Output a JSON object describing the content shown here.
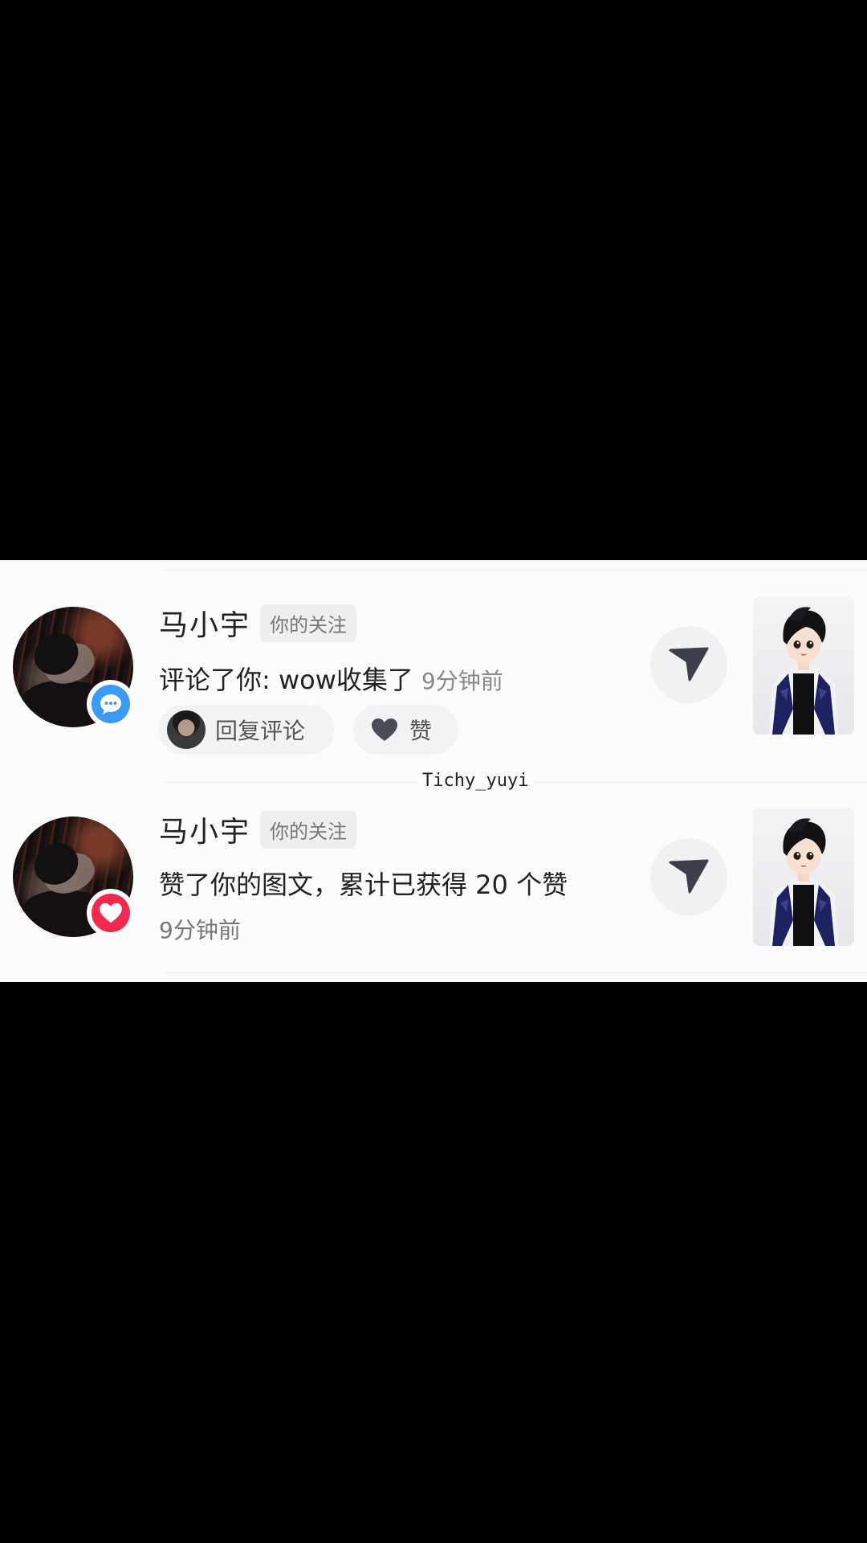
{
  "notifications": [
    {
      "user_name": "马小宇",
      "follow_tag": "你的关注",
      "badge_icon": "comment-bubble-icon",
      "badge_color": "#3b9af4",
      "message": "评论了你: wow收集了",
      "time": "9分钟前",
      "actions": {
        "reply_label": "回复评论",
        "like_label": "赞"
      }
    },
    {
      "user_name": "马小宇",
      "follow_tag": "你的关注",
      "badge_icon": "heart-icon",
      "badge_color": "#f0294f",
      "message": "赞了你的图文，累计已获得 20 个赞",
      "time": "9分钟前"
    }
  ],
  "watermark": "Tichy_yuyi",
  "colors": {
    "background": "#000000",
    "panel": "#fbfbfc",
    "comment_badge": "#3b9af4",
    "like_badge": "#f0294f",
    "share_icon": "#3d3f4c"
  }
}
